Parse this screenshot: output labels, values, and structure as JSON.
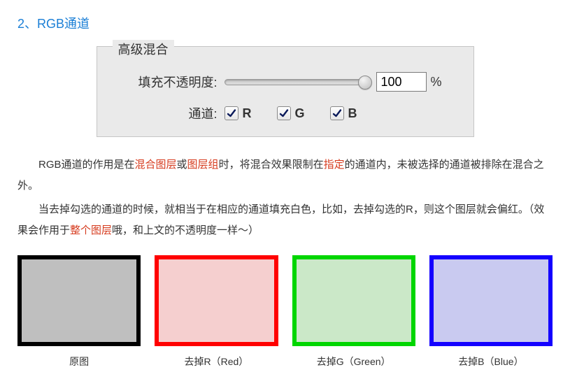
{
  "section_title": "2、RGB通道",
  "panel": {
    "legend": "高级混合",
    "opacity_label": "填充不透明度:",
    "opacity_value": "100",
    "opacity_unit": "%",
    "channels_label": "通道:",
    "channels": [
      {
        "label": "R"
      },
      {
        "label": "G"
      },
      {
        "label": "B"
      }
    ]
  },
  "para1": {
    "t1": "RGB通道的作用是在",
    "h1": "混合图层",
    "t2": "或",
    "h2": "图层组",
    "t3": "时，将混合效果限制在",
    "h3": "指定",
    "t4": "的通道内，未被选择的通道被排除在混合之外。"
  },
  "para2": {
    "t1": "当去掉勾选的通道的时候，就相当于在相应的通道填充白色，比如，去掉勾选的R，则这个图层就会偏红。（效果会作用于",
    "h1": "整个图层",
    "t2": "哦，和上文的不透明度一样～）"
  },
  "swatches": [
    {
      "label": "原图",
      "border": "#000000",
      "fill": "#bfbfbf"
    },
    {
      "label": "去掉R（Red）",
      "border": "#ff0000",
      "fill": "#f5cfcf"
    },
    {
      "label": "去掉G（Green）",
      "border": "#00d600",
      "fill": "#cbe8c8"
    },
    {
      "label": "去掉B（Blue）",
      "border": "#1400ff",
      "fill": "#c9caf0"
    }
  ]
}
